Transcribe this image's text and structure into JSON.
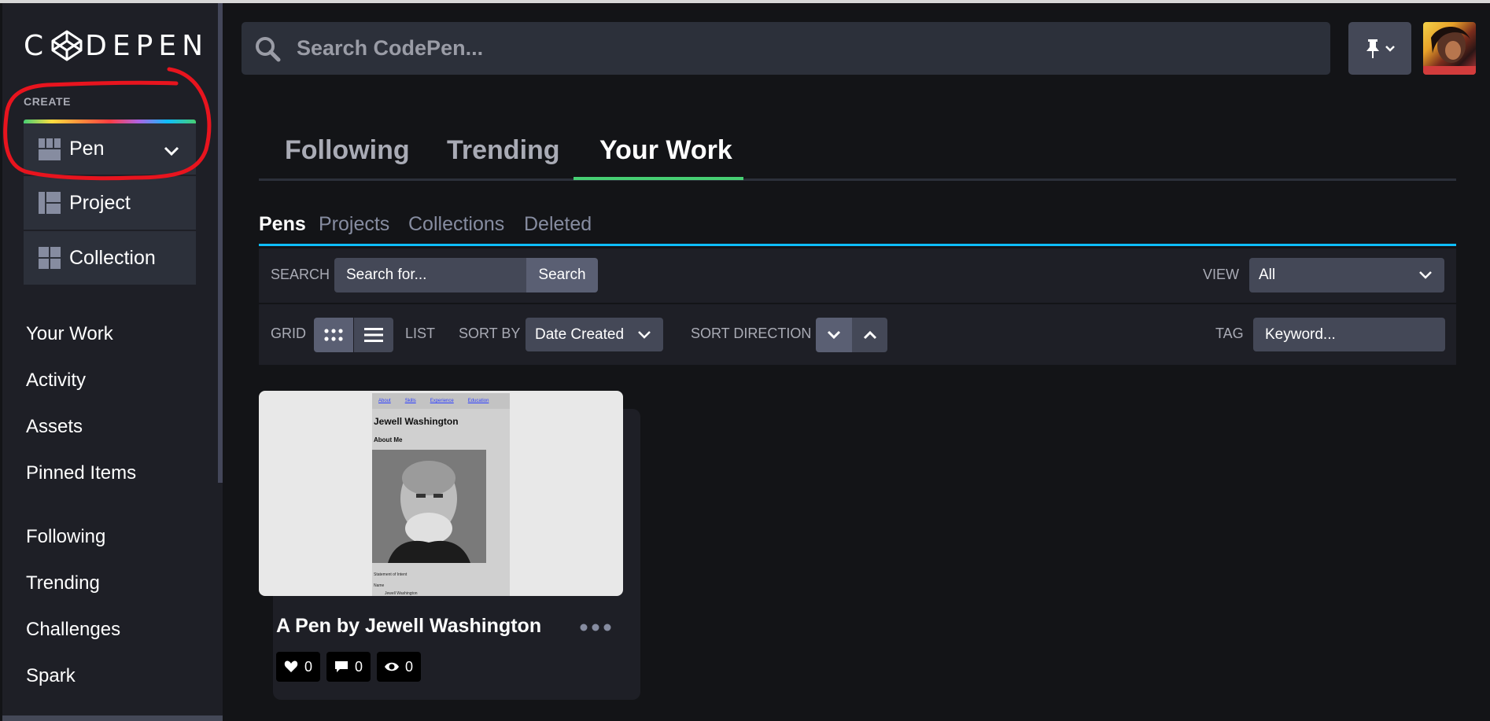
{
  "brand": {
    "logo_text": "CODEPEN"
  },
  "sidebar": {
    "create_label": "CREATE",
    "create_items": [
      {
        "label": "Pen",
        "icon": "pen-grid-icon"
      },
      {
        "label": "Project",
        "icon": "project-layout-icon"
      },
      {
        "label": "Collection",
        "icon": "collection-grid-icon"
      }
    ],
    "nav_primary": [
      "Your Work",
      "Activity",
      "Assets",
      "Pinned Items"
    ],
    "nav_secondary": [
      "Following",
      "Trending",
      "Challenges",
      "Spark"
    ]
  },
  "header": {
    "search_placeholder": "Search CodePen...",
    "pin_icon": "pushpin-icon"
  },
  "main_tabs": [
    "Following",
    "Trending",
    "Your Work"
  ],
  "main_tabs_active": "Your Work",
  "sub_tabs": [
    "Pens",
    "Projects",
    "Collections",
    "Deleted"
  ],
  "sub_tabs_active": "Pens",
  "filters": {
    "search_label": "SEARCH",
    "search_placeholder": "Search for...",
    "search_button": "Search",
    "view_label": "VIEW",
    "view_value": "All",
    "grid_label": "GRID",
    "list_label": "LIST",
    "sort_by_label": "SORT BY",
    "sort_by_value": "Date Created",
    "sort_direction_label": "SORT DIRECTION",
    "tag_label": "TAG",
    "tag_placeholder": "Keyword..."
  },
  "pens": [
    {
      "title": "A Pen by Jewell Washington",
      "likes": "0",
      "comments": "0",
      "views": "0",
      "preview": {
        "nav": [
          "About",
          "Skills",
          "Experience",
          "Education"
        ],
        "heading": "Jewell Washington",
        "subheading": "About Me",
        "footer_1": "Statement of Intent",
        "footer_2": "Name",
        "footer_3": "Jewell Washington"
      }
    }
  ],
  "colors": {
    "accent_green": "#47cf73",
    "accent_blue": "#0ebeff",
    "annotation_red": "#e8141e"
  }
}
